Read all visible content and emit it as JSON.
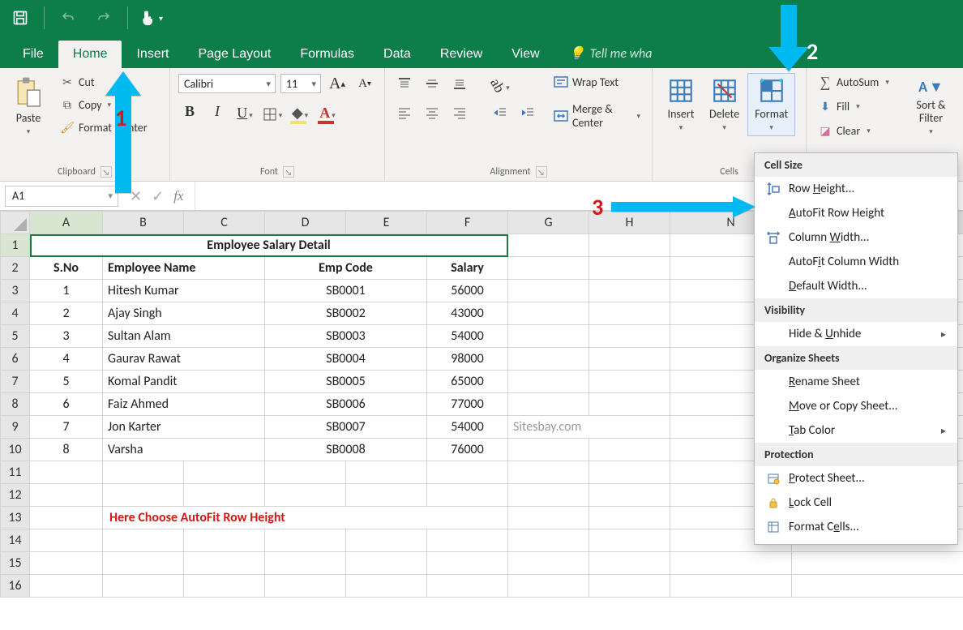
{
  "qat": {
    "save_icon": "save-icon",
    "undo_icon": "undo-icon",
    "redo_icon": "redo-icon",
    "touch_icon": "touch-mode-icon"
  },
  "tabs": {
    "file": "File",
    "home": "Home",
    "insert": "Insert",
    "page_layout": "Page Layout",
    "formulas": "Formulas",
    "data": "Data",
    "review": "Review",
    "view": "View",
    "tell_me": "Tell me wha"
  },
  "ribbon": {
    "clipboard": {
      "paste": "Paste",
      "cut": "Cut",
      "copy": "Copy",
      "format_painter": "Format Painter",
      "label": "Clipboard"
    },
    "font": {
      "name": "Calibri",
      "size": "11",
      "label": "Font"
    },
    "alignment": {
      "wrap_text": "Wrap Text",
      "merge_center": "Merge & Center",
      "label": "Alignment"
    },
    "cells": {
      "insert": "Insert",
      "delete": "Delete",
      "format": "Format",
      "label": "Cells"
    },
    "editing": {
      "autosum": "AutoSum",
      "fill": "Fill",
      "clear": "Clear",
      "sort_filter": "Sort & Filter"
    }
  },
  "name_box": "A1",
  "formula_value": "",
  "columns": [
    "A",
    "B",
    "C",
    "D",
    "E",
    "F",
    "G",
    "H",
    "N",
    ""
  ],
  "sheet": {
    "title": "Employee Salary Detail",
    "headers": {
      "sno": "S.No",
      "name": "Employee Name",
      "code": "Emp Code",
      "salary": "Salary"
    },
    "rows": [
      {
        "sno": "1",
        "name": "Hitesh Kumar",
        "code": "SB0001",
        "salary": "56000"
      },
      {
        "sno": "2",
        "name": "Ajay Singh",
        "code": "SB0002",
        "salary": "43000"
      },
      {
        "sno": "3",
        "name": "Sultan Alam",
        "code": "SB0003",
        "salary": "54000"
      },
      {
        "sno": "4",
        "name": "Gaurav Rawat",
        "code": "SB0004",
        "salary": "98000"
      },
      {
        "sno": "5",
        "name": "Komal Pandit",
        "code": "SB0005",
        "salary": "65000"
      },
      {
        "sno": "6",
        "name": "Faiz Ahmed",
        "code": "SB0006",
        "salary": "77000"
      },
      {
        "sno": "7",
        "name": "Jon Karter",
        "code": "SB0007",
        "salary": "54000"
      },
      {
        "sno": "8",
        "name": "Varsha",
        "code": "SB0008",
        "salary": "76000"
      }
    ],
    "watermark": "Sitesbay.com",
    "note": "Here Choose AutoFit Row Height"
  },
  "format_menu": {
    "section_cell_size": "Cell Size",
    "row_height": "Row Height...",
    "autofit_row_height": "AutoFit Row Height",
    "column_width": "Column Width...",
    "autofit_column_width": "AutoFit Column Width",
    "default_width": "Default Width...",
    "section_visibility": "Visibility",
    "hide_unhide": "Hide & Unhide",
    "section_organize": "Organize Sheets",
    "rename_sheet": "Rename Sheet",
    "move_copy": "Move or Copy Sheet...",
    "tab_color": "Tab Color",
    "section_protection": "Protection",
    "protect_sheet": "Protect Sheet...",
    "lock_cell": "Lock Cell",
    "format_cells": "Format Cells..."
  },
  "annotations": {
    "one": "1",
    "two": "2",
    "three": "3"
  }
}
